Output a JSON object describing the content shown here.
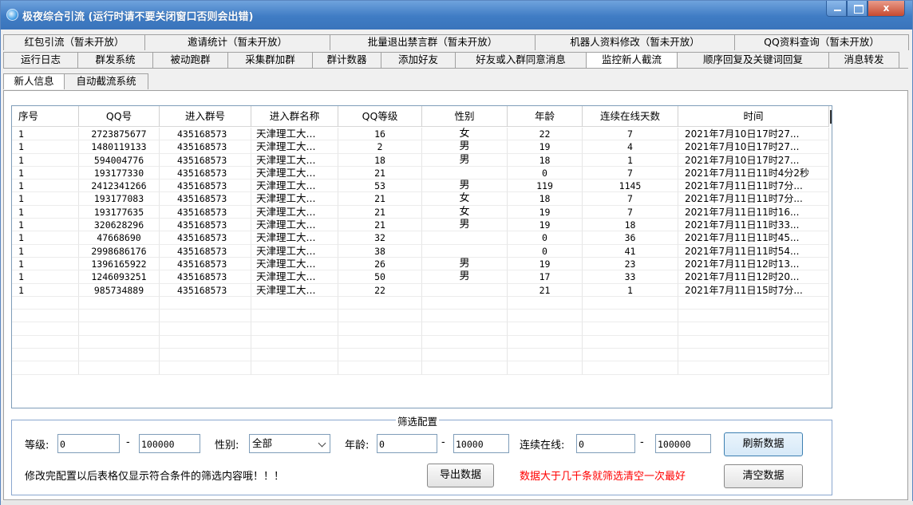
{
  "window": {
    "title": "极夜综合引流 (运行时请不要关闭窗口否则会出错)",
    "close_symbol": "x"
  },
  "tabs_row1": [
    {
      "label": "红包引流（暂未开放）"
    },
    {
      "label": "邀请统计（暂未开放）"
    },
    {
      "label": "批量退出禁言群（暂未开放）"
    },
    {
      "label": "机器人资料修改（暂未开放）"
    },
    {
      "label": "QQ资料查询（暂未开放）"
    }
  ],
  "tabs_row2": [
    {
      "label": "运行日志"
    },
    {
      "label": "群发系统"
    },
    {
      "label": "被动跑群"
    },
    {
      "label": "采集群加群"
    },
    {
      "label": "群计数器"
    },
    {
      "label": "添加好友"
    },
    {
      "label": "好友或入群同意消息"
    },
    {
      "label": "监控新人截流"
    },
    {
      "label": "顺序回复及关键词回复"
    },
    {
      "label": "消息转发"
    }
  ],
  "active_tab_row2": "监控新人截流",
  "subtabs": [
    {
      "label": "新人信息"
    },
    {
      "label": "自动截流系统"
    }
  ],
  "table": {
    "columns": [
      "序号",
      "QQ号",
      "进入群号",
      "进入群名称",
      "QQ等级",
      "性别",
      "年龄",
      "连续在线天数",
      "时间"
    ],
    "rows": [
      [
        "1",
        "2723875677",
        "435168573",
        "天津理工大...",
        "16",
        "女",
        "22",
        "7",
        "2021年7月10日17时27..."
      ],
      [
        "1",
        "1480119133",
        "435168573",
        "天津理工大...",
        "2",
        "男",
        "19",
        "4",
        "2021年7月10日17时27..."
      ],
      [
        "1",
        "594004776",
        "435168573",
        "天津理工大...",
        "18",
        "男",
        "18",
        "1",
        "2021年7月10日17时27..."
      ],
      [
        "1",
        "193177330",
        "435168573",
        "天津理工大...",
        "21",
        "",
        "0",
        "7",
        "2021年7月11日11时4分2秒"
      ],
      [
        "1",
        "2412341266",
        "435168573",
        "天津理工大...",
        "53",
        "男",
        "119",
        "1145",
        "2021年7月11日11时7分..."
      ],
      [
        "1",
        "193177083",
        "435168573",
        "天津理工大...",
        "21",
        "女",
        "18",
        "7",
        "2021年7月11日11时7分..."
      ],
      [
        "1",
        "193177635",
        "435168573",
        "天津理工大...",
        "21",
        "女",
        "19",
        "7",
        "2021年7月11日11时16..."
      ],
      [
        "1",
        "320628296",
        "435168573",
        "天津理工大...",
        "21",
        "男",
        "19",
        "18",
        "2021年7月11日11时33..."
      ],
      [
        "1",
        "47668690",
        "435168573",
        "天津理工大...",
        "32",
        "",
        "0",
        "36",
        "2021年7月11日11时45..."
      ],
      [
        "1",
        "2998686176",
        "435168573",
        "天津理工大...",
        "38",
        "",
        "0",
        "41",
        "2021年7月11日11时54..."
      ],
      [
        "1",
        "1396165922",
        "435168573",
        "天津理工大...",
        "26",
        "男",
        "19",
        "23",
        "2021年7月11日12时13..."
      ],
      [
        "1",
        "1246093251",
        "435168573",
        "天津理工大...",
        "50",
        "男",
        "17",
        "33",
        "2021年7月11日12时20..."
      ],
      [
        "1",
        "985734889",
        "435168573",
        "天津理工大...",
        "22",
        "",
        "21",
        "1",
        "2021年7月11日15时7分..."
      ]
    ],
    "empty_rows": 6
  },
  "filter": {
    "title": "筛选配置",
    "level_label": "等级:",
    "level_min": "0",
    "level_max": "100000",
    "dash": "-",
    "gender_label": "性别:",
    "gender_value": "全部",
    "age_label": "年龄:",
    "age_min": "0",
    "age_max": "10000",
    "online_label": "连续在线:",
    "online_min": "0",
    "online_max": "100000",
    "refresh_button": "刷新数据",
    "export_button": "导出数据",
    "clear_button": "清空数据",
    "hint": "修改完配置以后表格仅显示符合条件的筛选内容哦！！！",
    "warning": "数据大于几千条就筛选清空一次最好",
    "warning_color": "#ff0000"
  }
}
